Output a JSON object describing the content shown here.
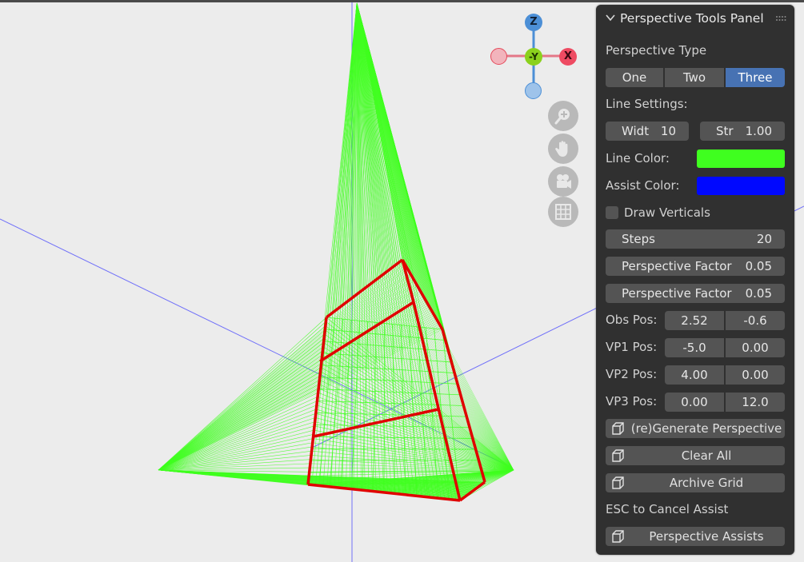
{
  "panel": {
    "title": "Perspective Tools Panel",
    "perspective_type_label": "Perspective Type",
    "type_options": [
      "One",
      "Two",
      "Three"
    ],
    "type_selected": "Three",
    "line_settings_label": "Line Settings:",
    "width": {
      "label": "Widt",
      "value": "10"
    },
    "strength": {
      "label": "Str",
      "value": "1.00"
    },
    "line_color_label": "Line Color:",
    "line_color": "#3fff1f",
    "assist_color_label": "Assist Color:",
    "assist_color": "#0008ff",
    "draw_verticals_label": "Draw Verticals",
    "draw_verticals_checked": false,
    "steps": {
      "label": "Steps",
      "value": "20"
    },
    "perspective_factor_1": {
      "label": "Perspective Factor",
      "value": "0.05"
    },
    "perspective_factor_2": {
      "label": "Perspective Factor",
      "value": "0.05"
    },
    "obs_pos": {
      "label": "Obs Pos:",
      "x": "2.52",
      "y": "-0.6"
    },
    "vp1_pos": {
      "label": "VP1 Pos:",
      "x": "-5.0",
      "y": "0.00"
    },
    "vp2_pos": {
      "label": "VP2 Pos:",
      "x": "4.00",
      "y": "0.00"
    },
    "vp3_pos": {
      "label": "VP3 Pos:",
      "x": "0.00",
      "y": "12.0"
    },
    "regenerate_label": "(re)Generate Perspective",
    "clear_all_label": "Clear All",
    "archive_grid_label": "Archive Grid",
    "esc_hint": "ESC to Cancel Assist",
    "assists_label": "Perspective Assists"
  },
  "gizmo": {
    "z": "Z",
    "neg_y": "-Y",
    "x": "X"
  },
  "colors": {
    "panel_bg": "#303030",
    "accent": "#4772b3",
    "grid_green": "#3fff1f",
    "frame_red": "#e00000",
    "axis_blue": "#3a3aff"
  },
  "icons": [
    "zoom-icon",
    "hand-icon",
    "camera-icon",
    "grid-icon",
    "cube-icon",
    "chevron-down-icon",
    "drag-handle-icon"
  ]
}
